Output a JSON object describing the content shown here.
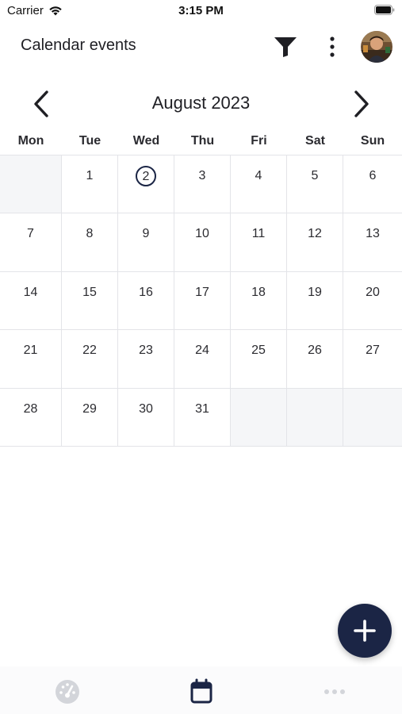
{
  "status_bar": {
    "carrier": "Carrier",
    "time": "3:15 PM"
  },
  "app_bar": {
    "title": "Calendar events",
    "icons": [
      "filter-icon",
      "more-vertical-icon",
      "avatar"
    ]
  },
  "calendar": {
    "month_label": "August 2023",
    "prev_icon": "chevron-left-icon",
    "next_icon": "chevron-right-icon",
    "weekdays": [
      "Mon",
      "Tue",
      "Wed",
      "Thu",
      "Fri",
      "Sat",
      "Sun"
    ],
    "weeks": [
      [
        "",
        "1",
        "2",
        "3",
        "4",
        "5",
        "6"
      ],
      [
        "7",
        "8",
        "9",
        "10",
        "11",
        "12",
        "13"
      ],
      [
        "14",
        "15",
        "16",
        "17",
        "18",
        "19",
        "20"
      ],
      [
        "21",
        "22",
        "23",
        "24",
        "25",
        "26",
        "27"
      ],
      [
        "28",
        "29",
        "30",
        "31",
        "",
        "",
        ""
      ]
    ],
    "today": "2"
  },
  "fab": {
    "icon": "plus-icon"
  },
  "bottom_nav": {
    "tabs": [
      {
        "icon": "dashboard-gauge-icon",
        "active": false
      },
      {
        "icon": "calendar-icon",
        "active": true
      },
      {
        "icon": "more-horizontal-icon",
        "active": false
      }
    ]
  },
  "colors": {
    "accent": "#1b2545",
    "grid_line": "#e3e4e8",
    "empty_cell": "#f5f6f8",
    "inactive_icon": "#d3d5da"
  }
}
